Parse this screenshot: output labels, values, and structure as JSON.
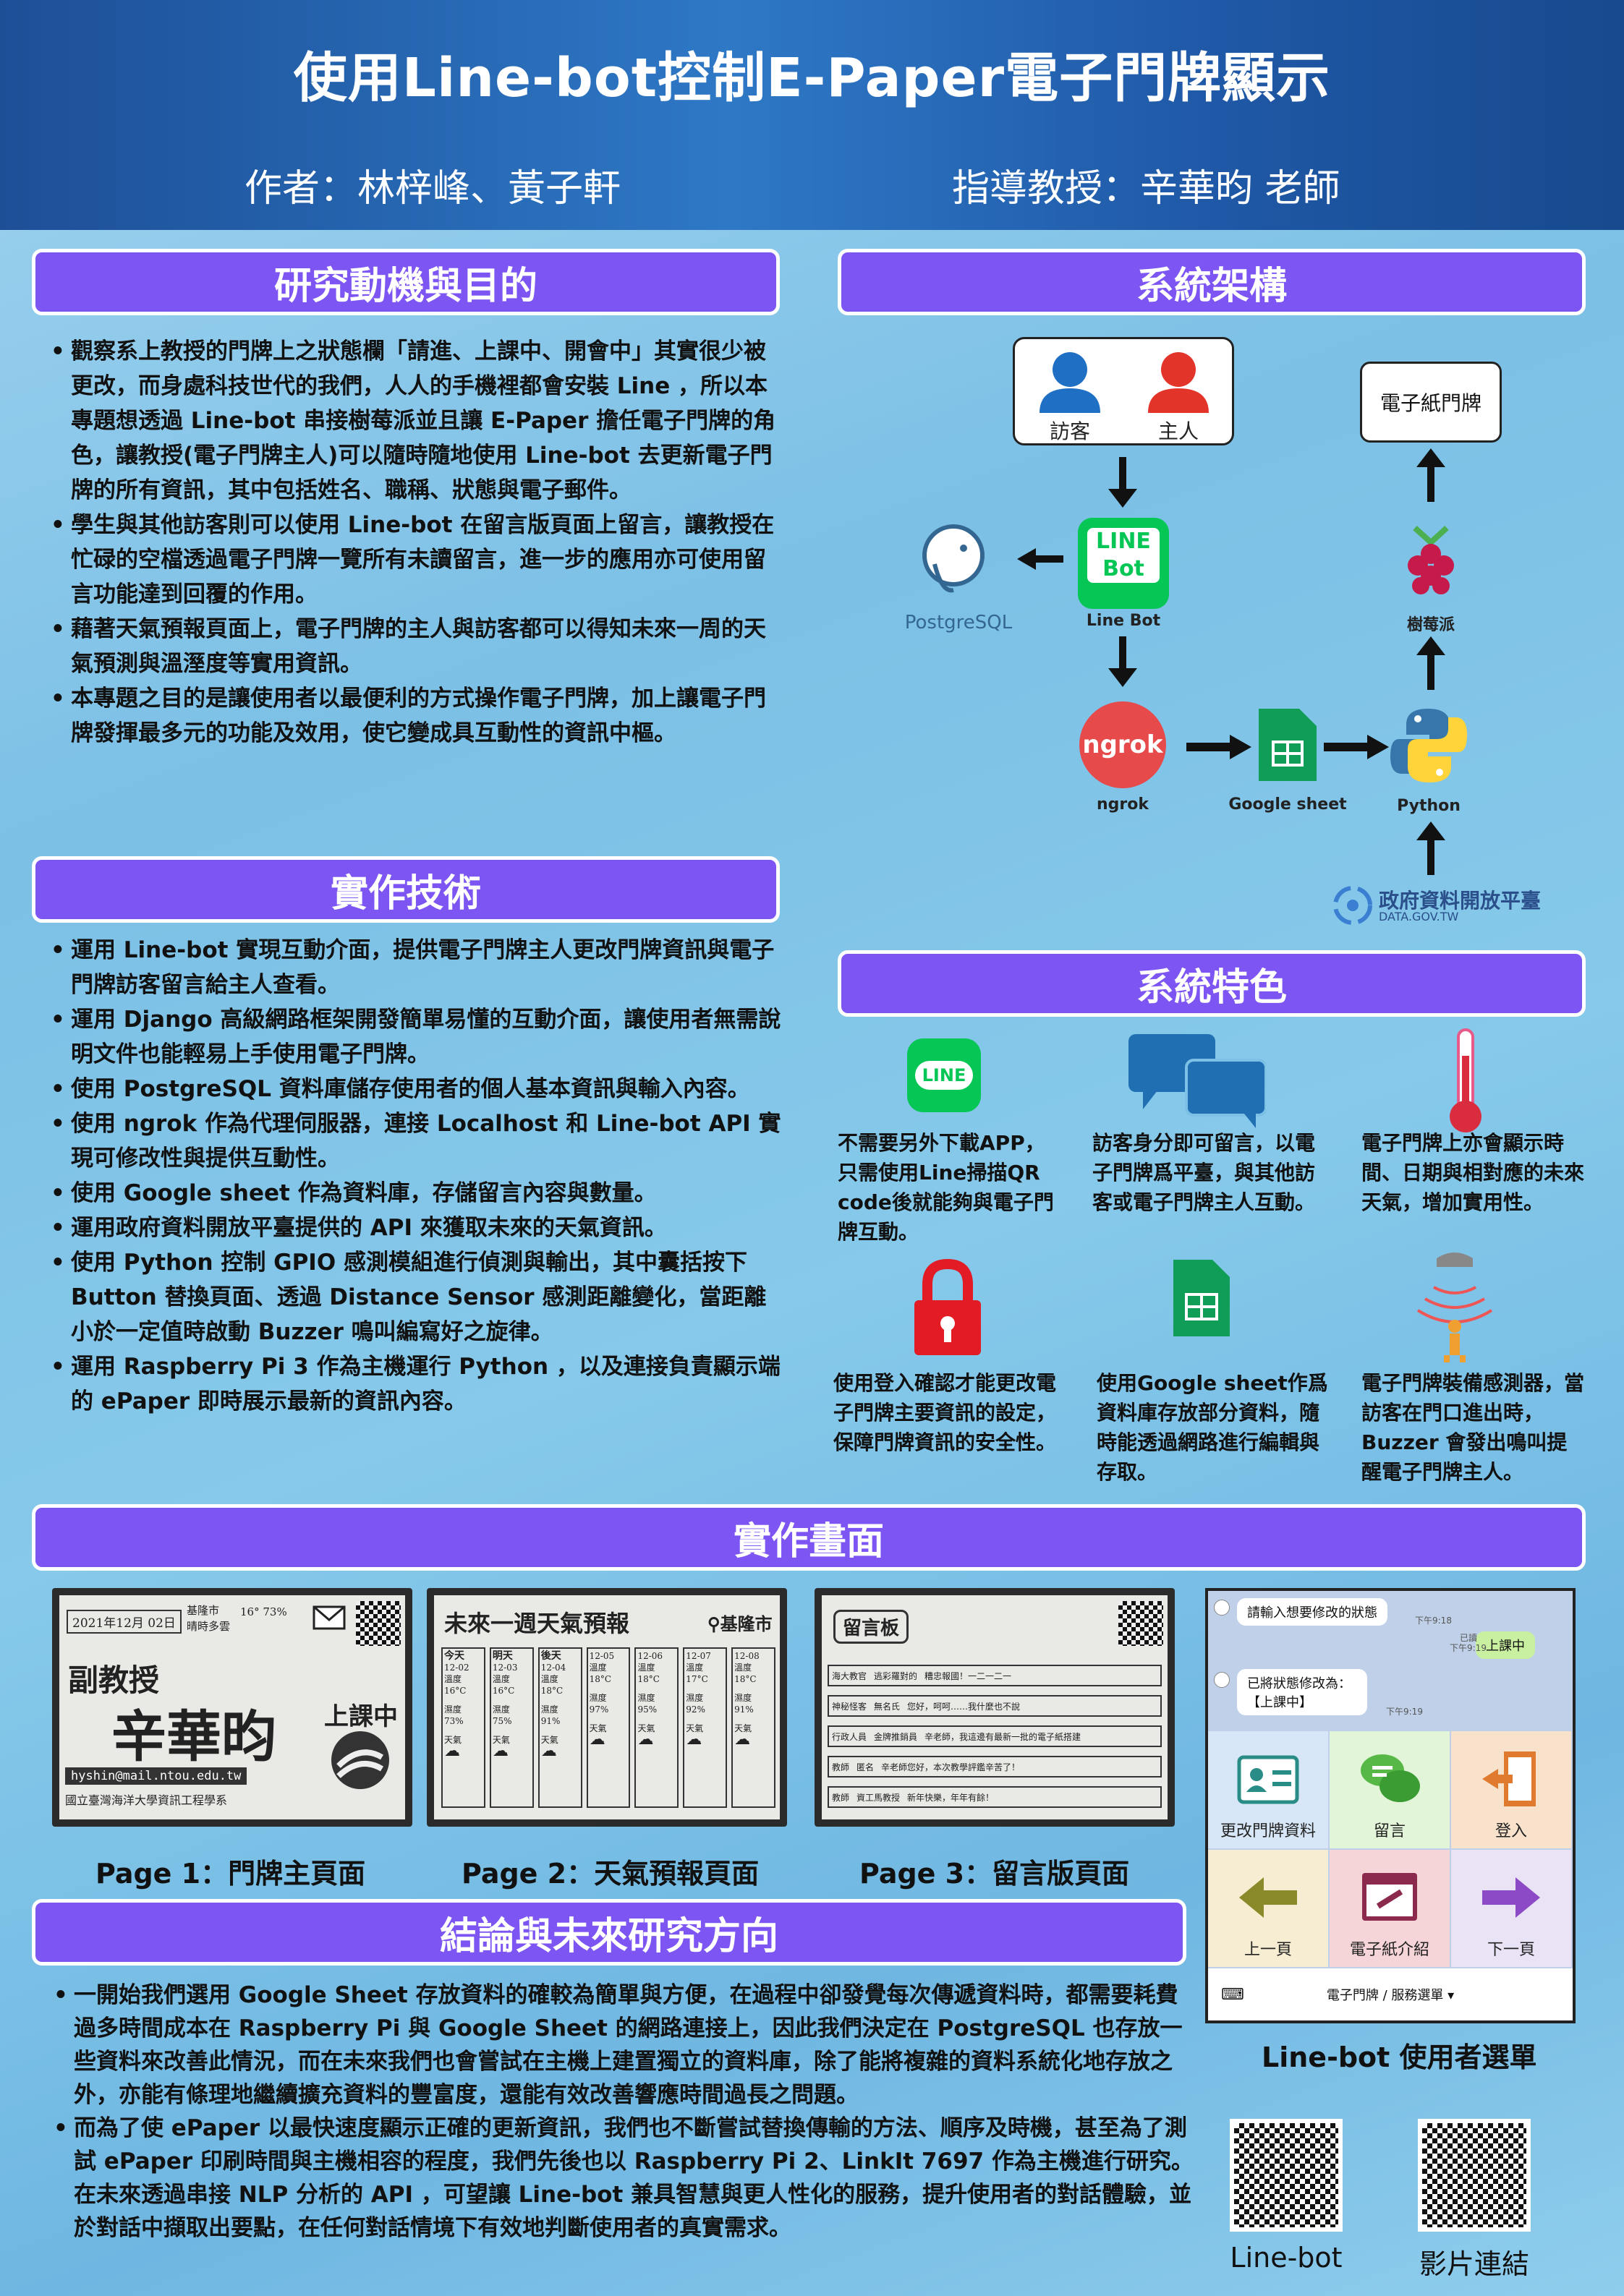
{
  "header": {
    "title": "使用Line-bot控制E-Paper電子門牌顯示",
    "authors": "作者：林梓峰、黃子軒",
    "advisor": "指導教授：辛華昀 老師"
  },
  "motivation": {
    "heading": "研究動機與目的",
    "bullets": [
      "觀察系上教授的門牌上之狀態欄「請進、上課中、開會中」其實很少被更改，而身處科技世代的我們，人人的手機裡都會安裝 Line ，所以本專題想透過 Line-bot 串接樹莓派並且讓 E-Paper 擔任電子門牌的角色，讓教授(電子門牌主人)可以隨時隨地使用 Line-bot 去更新電子門牌的所有資訊，其中包括姓名、職稱、狀態與電子郵件。",
      "學生與其他訪客則可以使用 Line-bot 在留言版頁面上留言，讓教授在忙碌的空檔透過電子門牌一覽所有未讀留言，進一步的應用亦可使用留言功能達到回覆的作用。",
      "藉著天氣預報頁面上，電子門牌的主人與訪客都可以得知未來一周的天氣預測與溫溼度等實用資訊。",
      "本專題之目的是讓使用者以最便利的方式操作電子門牌，加上讓電子門牌發揮最多元的功能及效用，使它變成具互動性的資訊中樞。"
    ]
  },
  "tech": {
    "heading": "實作技術",
    "bullets": [
      "運用 Line-bot 實現互動介面，提供電子門牌主人更改門牌資訊與電子門牌訪客留言給主人查看。",
      "運用 Django 高級網路框架開發簡單易懂的互動介面，讓使用者無需說明文件也能輕易上手使用電子門牌。",
      "使用 PostgreSQL 資料庫儲存使用者的個人基本資訊與輸入內容。",
      "使用 ngrok 作為代理伺服器，連接 Localhost 和 Line-bot API 實現可修改性與提供互動性。",
      "使用 Google sheet 作為資料庫，存儲留言內容與數量。",
      "運用政府資料開放平臺提供的 API 來獲取未來的天氣資訊。",
      "使用 Python 控制 GPIO 感測模組進行偵測與輸出，其中囊括按下 Button 替換頁面、透過 Distance Sensor 感測距離變化，當距離小於一定值時啟動 Buzzer 鳴叫編寫好之旋律。",
      "運用 Raspberry Pi 3 作為主機運行 Python ，以及連接負責顯示端的 ePaper 即時展示最新的資訊內容。"
    ]
  },
  "architecture": {
    "heading": "系統架構",
    "visitor": "訪客",
    "owner": "主人",
    "epaper": "電子紙門牌",
    "linebot_logo": "LINE Bot",
    "linebot": "Line Bot",
    "postgres": "PostgreSQL",
    "raspberry": "樹莓派",
    "ngrok": "ngrok",
    "google_sheet": "Google sheet",
    "python": "Python",
    "gov_data": "政府資料開放平臺",
    "gov_data_sub": "DATA.GOV.TW"
  },
  "features": {
    "heading": "系統特色",
    "items": [
      {
        "icon": "line-icon",
        "label": "LINE",
        "text": "不需要另外下載APP，只需使用Line掃描QR code後就能夠與電子門牌互動。"
      },
      {
        "icon": "chat-bubbles-icon",
        "text": "訪客身分即可留言，以電子門牌爲平臺，與其他訪客或電子門牌主人互動。"
      },
      {
        "icon": "thermometer-icon",
        "text": "電子門牌上亦會顯示時間、日期與相對應的未來天氣，增加實用性。"
      },
      {
        "icon": "lock-icon",
        "text": "使用登入確認才能更改電子門牌主要資訊的設定，保障門牌資訊的安全性。"
      },
      {
        "icon": "sheet-icon",
        "text": "使用Google sheet作爲資料庫存放部分資料，隨時能透過網路進行編輯與存取。"
      },
      {
        "icon": "sensor-icon",
        "text": "電子門牌裝備感測器，當訪客在門口進出時，Buzzer 會發出鳴叫提醒電子門牌主人。"
      }
    ]
  },
  "screens": {
    "heading": "實作畫面",
    "page1": {
      "caption": "Page 1：門牌主頁面",
      "date": "2021年12月 02日",
      "city": "基隆市",
      "temp": "16° 73%",
      "weather": "晴時多雲",
      "title": "副教授",
      "name": "辛華昀",
      "status": "上課中",
      "email": "hyshin@mail.ntou.edu.tw",
      "dept": "國立臺灣海洋大學資訊工程學系"
    },
    "page2": {
      "caption": "Page 2：天氣預報頁面",
      "title": "未來一週天氣預報",
      "city": "基隆市",
      "days": [
        {
          "d": "今天",
          "date": "12-02",
          "t": "16°C",
          "h": "73%"
        },
        {
          "d": "明天",
          "date": "12-03",
          "t": "16°C",
          "h": "75%"
        },
        {
          "d": "後天",
          "date": "12-04",
          "t": "18°C",
          "h": "91%"
        },
        {
          "d": "",
          "date": "12-05",
          "t": "18°C",
          "h": "97%"
        },
        {
          "d": "",
          "date": "12-06",
          "t": "18°C",
          "h": "95%"
        },
        {
          "d": "",
          "date": "12-07",
          "t": "17°C",
          "h": "92%"
        },
        {
          "d": "",
          "date": "12-08",
          "t": "18°C",
          "h": "91%"
        }
      ],
      "temp_label": "溫度",
      "hum_label": "濕度",
      "weather_label": "天氣"
    },
    "page3": {
      "caption": "Page 3：留言版頁面",
      "title": "留言板",
      "rows": [
        {
          "who": "海大教官",
          "name": "逃彩羅對的",
          "msg": "糟忠報國！一二一二一"
        },
        {
          "who": "神秘怪客",
          "name": "無名氏",
          "msg": "您好，呵呵……我什麼也不說"
        },
        {
          "who": "行政人員",
          "name": "金牌推銷員",
          "msg": "辛老師，我這邊有最新一批的電子紙搭建"
        },
        {
          "who": "教師",
          "name": "匿名",
          "msg": "辛老師您好，本次教學評鑑辛苦了！"
        },
        {
          "who": "教師",
          "name": "資工馬教授",
          "msg": "新年快樂，年年有餘！"
        }
      ]
    },
    "linebot": {
      "caption": "Line-bot 使用者選單",
      "msg1": "請輸入想要修改的狀態",
      "time1": "下午9:18",
      "reply": "上課中",
      "read": "已讀",
      "time2": "下午9:19",
      "msg2": "已將狀態修改為：【上課中】",
      "time3": "下午9:19",
      "menu": [
        {
          "label": "更改門牌資料",
          "icon": "profile-card-icon"
        },
        {
          "label": "留言",
          "icon": "comments-icon"
        },
        {
          "label": "登入",
          "icon": "login-door-icon"
        },
        {
          "label": "上一頁",
          "icon": "arrow-left-icon"
        },
        {
          "label": "電子紙介紹",
          "icon": "link-window-icon"
        },
        {
          "label": "下一頁",
          "icon": "arrow-right-icon"
        }
      ],
      "footer": "電子門牌 / 服務選單 ▾"
    }
  },
  "conclusion": {
    "heading": "結論與未來研究方向",
    "bullets": [
      "一開始我們選用 Google Sheet 存放資料的確較為簡單與方便，在過程中卻發覺每次傳遞資料時，都需要耗費過多時間成本在 Raspberry Pi 與 Google Sheet 的網路連接上，因此我們決定在 PostgreSQL 也存放一些資料來改善此情況，而在未來我們也會嘗試在主機上建置獨立的資料庫，除了能將複雜的資料系統化地存放之外，亦能有條理地繼續擴充資料的豐富度，還能有效改善響應時間過長之問題。",
      "而為了使 ePaper 以最快速度顯示正確的更新資訊，我們也不斷嘗試替換傳輸的方法、順序及時機，甚至為了測試 ePaper 印刷時間與主機相容的程度，我們先後也以 Raspberry Pi 2、LinkIt 7697 作為主機進行研究。在未來透過串接 NLP 分析的 API ，可望讓 Line-bot 兼具智慧與更人性化的服務，提升使用者的對話體驗，並於對話中擷取出要點，在任何對話情境下有效地判斷使用者的真實需求。"
    ]
  },
  "qr": {
    "linebot": "Line-bot",
    "video": "影片連結"
  }
}
